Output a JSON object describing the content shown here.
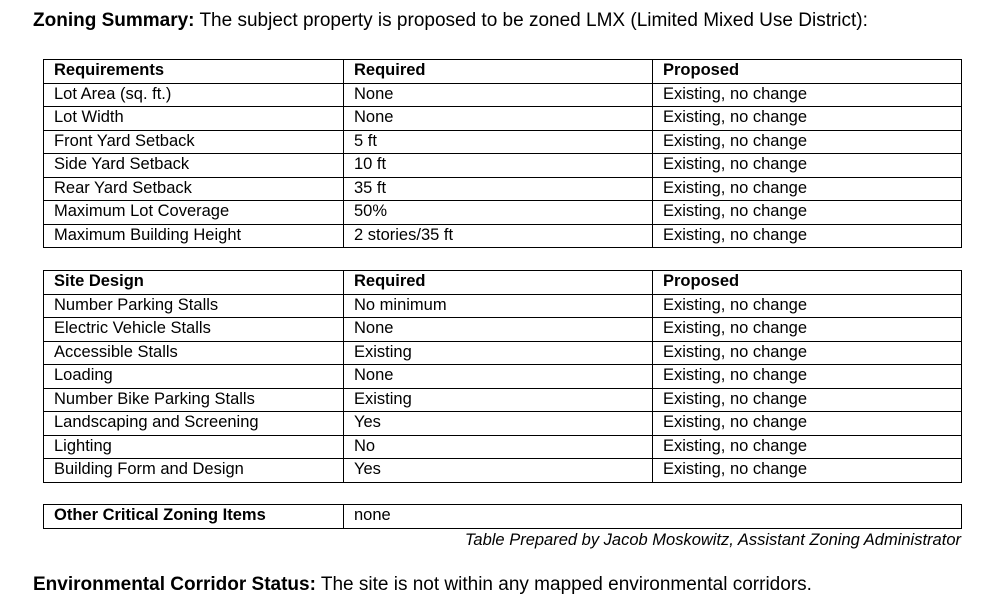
{
  "zoning_summary": {
    "label": "Zoning Summary:",
    "text": " The subject property is proposed to be zoned LMX (Limited Mixed Use District):"
  },
  "requirements_table": {
    "headers": [
      "Requirements",
      "Required",
      "Proposed"
    ],
    "rows": [
      [
        "Lot Area (sq. ft.)",
        "None",
        "Existing, no change"
      ],
      [
        "Lot Width",
        "None",
        "Existing, no change"
      ],
      [
        "Front Yard Setback",
        "5 ft",
        "Existing, no change"
      ],
      [
        "Side Yard Setback",
        "10 ft",
        "Existing, no change"
      ],
      [
        "Rear Yard Setback",
        "35 ft",
        "Existing, no change"
      ],
      [
        "Maximum Lot Coverage",
        "50%",
        "Existing, no change"
      ],
      [
        "Maximum Building Height",
        "2 stories/35 ft",
        "Existing, no change"
      ]
    ]
  },
  "site_design_table": {
    "headers": [
      "Site Design",
      "Required",
      "Proposed"
    ],
    "rows": [
      [
        "Number Parking Stalls",
        "No minimum",
        "Existing, no change"
      ],
      [
        "Electric Vehicle Stalls",
        "None",
        "Existing, no change"
      ],
      [
        "Accessible Stalls",
        "Existing",
        "Existing, no change"
      ],
      [
        "Loading",
        "None",
        "Existing, no change"
      ],
      [
        "Number Bike Parking Stalls",
        "Existing",
        "Existing, no change"
      ],
      [
        "Landscaping and Screening",
        "Yes",
        "Existing, no change"
      ],
      [
        "Lighting",
        "No",
        "Existing, no change"
      ],
      [
        "Building Form and Design",
        "Yes",
        "Existing, no change"
      ]
    ]
  },
  "other_items": {
    "label": "Other Critical Zoning Items",
    "value": "none"
  },
  "credit": "Table Prepared by Jacob Moskowitz, Assistant Zoning Administrator",
  "environmental": {
    "label": "Environmental Corridor Status:",
    "text": " The site is not within any mapped environmental corridors."
  }
}
